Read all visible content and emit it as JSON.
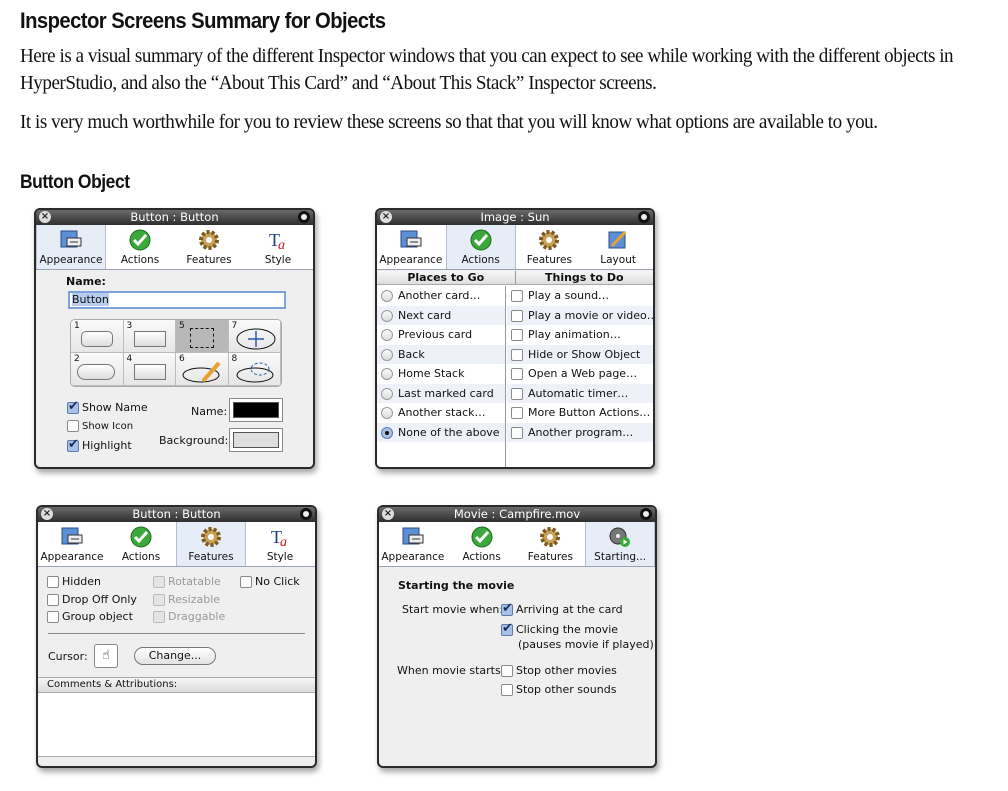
{
  "doc": {
    "title": "Inspector Screens Summary for Objects",
    "para1_line1": "Here is a visual summary of the different Inspector windows that you can expect to see while working with the different objects in",
    "para1_line2": "HyperStudio, and also the “About This Card” and “About This Stack” Inspector screens.",
    "para2": "It is very much worthwhile for you to review these screens so that that you will know what options are available to you.",
    "section": "Button Object"
  },
  "windows": {
    "appearance": {
      "title": "Button : Button",
      "tabs": [
        "Appearance",
        "Actions",
        "Features",
        "Style"
      ],
      "selected_tab": "Appearance",
      "name_label": "Name:",
      "name_value": "Button",
      "styles": [
        "1",
        "3",
        "5",
        "7",
        "2",
        "4",
        "6",
        "8"
      ],
      "selected_style": "5",
      "show_name": "Show Name",
      "show_icon": "Show Icon",
      "highlight": "Highlight",
      "color_name_label": "Name:",
      "color_bg_label": "Background:",
      "name_color": "#000000",
      "bg_color": "#e0e0e0"
    },
    "actions": {
      "title": "Image : Sun",
      "tabs": [
        "Appearance",
        "Actions",
        "Features",
        "Layout"
      ],
      "selected_tab": "Actions",
      "places_header": "Places to Go",
      "things_header": "Things to Do",
      "places": [
        "Another card…",
        "Next card",
        "Previous card",
        "Back",
        "Home Stack",
        "Last marked card",
        "Another stack…",
        "None of the above"
      ],
      "selected_place": "None of the above",
      "things": [
        "Play a sound…",
        "Play a movie or video…",
        "Play animation…",
        "Hide or Show Object",
        "Open a Web page…",
        "Automatic timer…",
        "More Button Actions…",
        "Another program…"
      ]
    },
    "features": {
      "title": "Button : Button",
      "tabs": [
        "Appearance",
        "Actions",
        "Features",
        "Style"
      ],
      "selected_tab": "Features",
      "hidden": "Hidden",
      "drop_off_only": "Drop Off Only",
      "group_object": "Group object",
      "rotatable": "Rotatable",
      "resizable": "Resizable",
      "draggable": "Draggable",
      "no_click": "No Click",
      "cursor_label": "Cursor:",
      "change_button": "Change...",
      "comments_label": "Comments & Attributions:"
    },
    "movie": {
      "title": "Movie : Campfire.mov",
      "tabs": [
        "Appearance",
        "Actions",
        "Features",
        "Starting..."
      ],
      "selected_tab": "Starting...",
      "heading": "Starting the movie",
      "start_when_label": "Start movie when:",
      "arriving": "Arriving at the card",
      "clicking": "Clicking the movie",
      "clicking_note": "(pauses movie if played)",
      "when_starts_label": "When movie starts:",
      "stop_movies": "Stop other movies",
      "stop_sounds": "Stop other sounds"
    }
  }
}
